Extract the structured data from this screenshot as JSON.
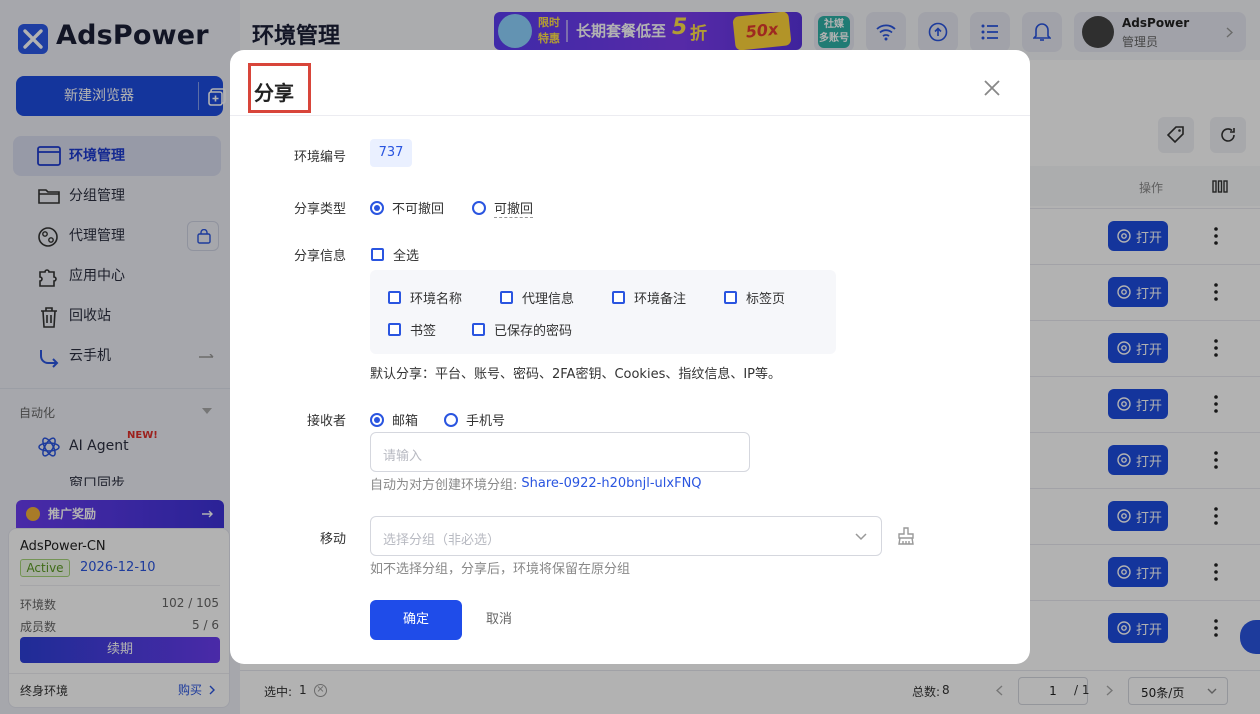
{
  "app": {
    "brand": "AdsPower"
  },
  "sidebar": {
    "new_browser": "新建浏览器",
    "nav": [
      {
        "label": "环境管理",
        "icon": "browser-window-icon",
        "active": true
      },
      {
        "label": "分组管理",
        "icon": "folder-icon"
      },
      {
        "label": "代理管理",
        "icon": "proxy-icon"
      },
      {
        "label": "应用中心",
        "icon": "puzzle-icon"
      },
      {
        "label": "回收站",
        "icon": "trash-icon"
      },
      {
        "label": "云手机",
        "icon": "cloud-phone-icon"
      }
    ],
    "section_automation": "自动化",
    "ai_agent": "AI Agent",
    "ai_agent_badge": "NEW!",
    "hidden_item": "窗口同步",
    "promo_label": "推广奖励",
    "account": {
      "team": "AdsPower-CN",
      "status": "Active",
      "expiry": "2026-12-10",
      "env_label": "环境数",
      "env_count": "102 / 105",
      "member_label": "成员数",
      "member_count": "5 / 6",
      "renew": "续期",
      "lifetime": "终身环境",
      "buy": "购买"
    }
  },
  "header": {
    "page_title": "环境管理",
    "banner": {
      "tag1": "限时",
      "tag2": "特惠",
      "text": "长期套餐低至",
      "num": "5",
      "unit": "折",
      "badge": "50x"
    },
    "social": {
      "line1": "社媒",
      "line2": "多账号"
    },
    "user": {
      "name": "AdsPower",
      "role": "管理员"
    }
  },
  "table": {
    "col_action": "操作",
    "open_label": "打开",
    "rows": 8
  },
  "footer": {
    "selected_label": "选中:",
    "selected_count": "1",
    "total_label": "总数:",
    "total_count": "8",
    "page": "1",
    "page_total": "/ 1",
    "page_size": "50条/页"
  },
  "modal": {
    "title": "分享",
    "env_id_label": "环境编号",
    "env_id": "737",
    "share_type_label": "分享类型",
    "share_types": [
      {
        "label": "不可撤回",
        "selected": true
      },
      {
        "label": "可撤回",
        "selected": false
      }
    ],
    "share_info_label": "分享信息",
    "select_all": "全选",
    "info_options": [
      "环境名称",
      "代理信息",
      "环境备注",
      "标签页",
      "书签",
      "已保存的密码"
    ],
    "default_note": "默认分享：平台、账号、密码、2FA密钥、Cookies、指纹信息、IP等。",
    "receiver_label": "接收者",
    "receiver_types": [
      {
        "label": "邮箱",
        "selected": true
      },
      {
        "label": "手机号",
        "selected": false
      }
    ],
    "receiver_placeholder": "请输入",
    "auto_group_prefix": "自动为对方创建环境分组:",
    "auto_group_name": "Share-0922-h20bnjl-ulxFNQ",
    "move_label": "移动",
    "move_placeholder": "选择分组（非必选）",
    "move_hint": "如不选择分组，分享后，环境将保留在原分组",
    "confirm": "确定",
    "cancel": "取消"
  },
  "colors": {
    "primary": "#1f4ce9",
    "highlight_box": "#d8453a",
    "active_badge": "#7bbf3a"
  }
}
